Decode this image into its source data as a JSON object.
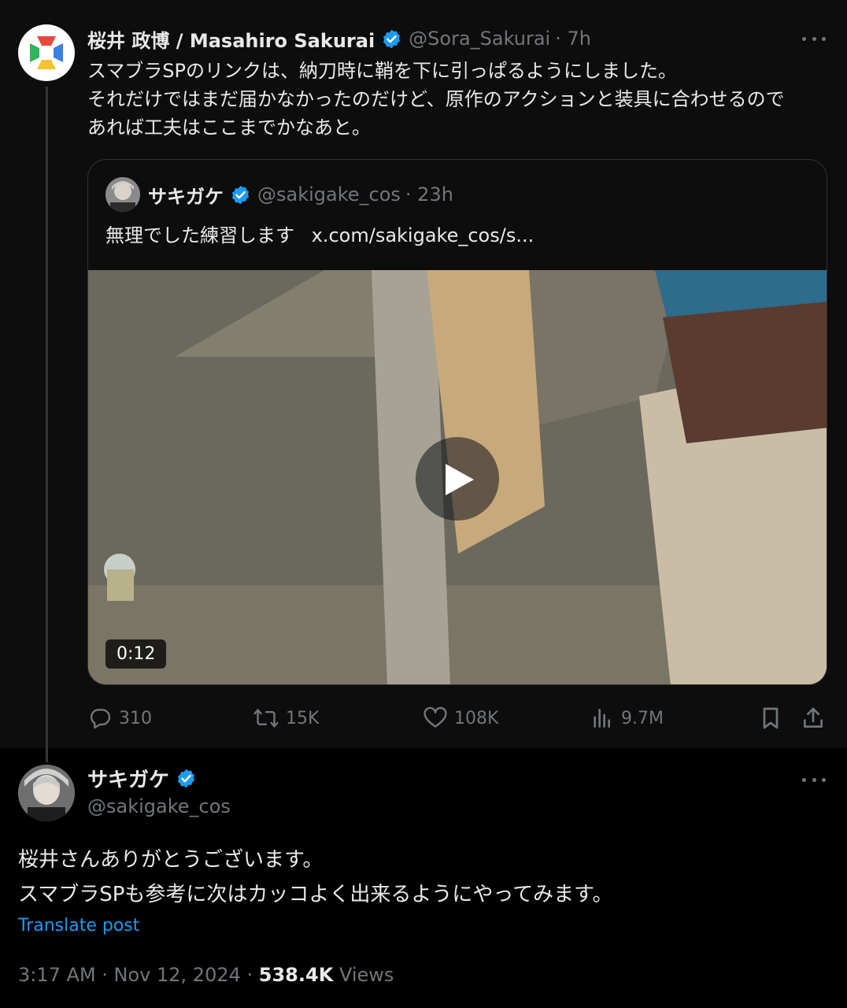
{
  "main_post": {
    "author_name": "桜井 政博 / Masahiro Sakurai",
    "handle": "@Sora_Sakurai",
    "time": "· 7h",
    "text_lines": [
      "スマブラSPのリンクは、納刀時に鞘を下に引っぱるようにしました。",
      "それだけではまだ届かなかったのだけど、原作のアクションと装具に合わせるので",
      "あれば工夫はここまでかなあと。"
    ],
    "quoted": {
      "author_name": "サキガケ",
      "handle": "@sakigake_cos",
      "time": "· 23h",
      "text": "無理でした練習します",
      "link": "x.com/sakigake_cos/s...",
      "video_duration": "0:12"
    },
    "actions": {
      "replies": "310",
      "reposts": "15K",
      "likes": "108K",
      "views": "9.7M"
    }
  },
  "reply_post": {
    "author_name": "サキガケ",
    "handle": "@sakigake_cos",
    "text_lines": [
      "桜井さんありがとうございます。",
      "スマブラSPも参考に次はカッコよく出来るようにやってみます。"
    ],
    "translate_label": "Translate post",
    "time": "3:17 AM · Nov 12, 2024 ·",
    "views_count": "538.4K",
    "views_label": "Views"
  },
  "colors": {
    "verified_blue": "#1d9bf0",
    "muted_text": "#71767b",
    "primary_text": "#e7e9ea",
    "logo_red": "#e8473d",
    "logo_blue": "#3a7ee6",
    "logo_green": "#2fb55b",
    "logo_yellow": "#f2c230"
  }
}
